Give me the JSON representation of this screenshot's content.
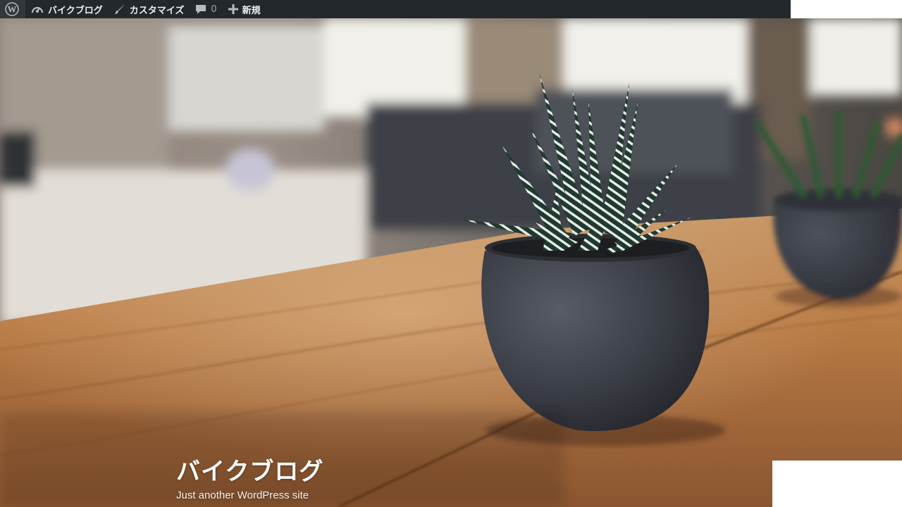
{
  "admin_bar": {
    "site_name": "バイクブログ",
    "customize_label": "カスタマイズ",
    "comments_count": "0",
    "new_label": "新規",
    "colors": {
      "background": "#23282d",
      "text": "#eeeeee"
    }
  },
  "branding": {
    "site_title": "バイクブログ",
    "site_description": "Just another WordPress site"
  },
  "header_media": {
    "icon": "succulent-plant-photo",
    "colors": {
      "wood": "#b87a44",
      "pot": "#3a3d45"
    }
  }
}
